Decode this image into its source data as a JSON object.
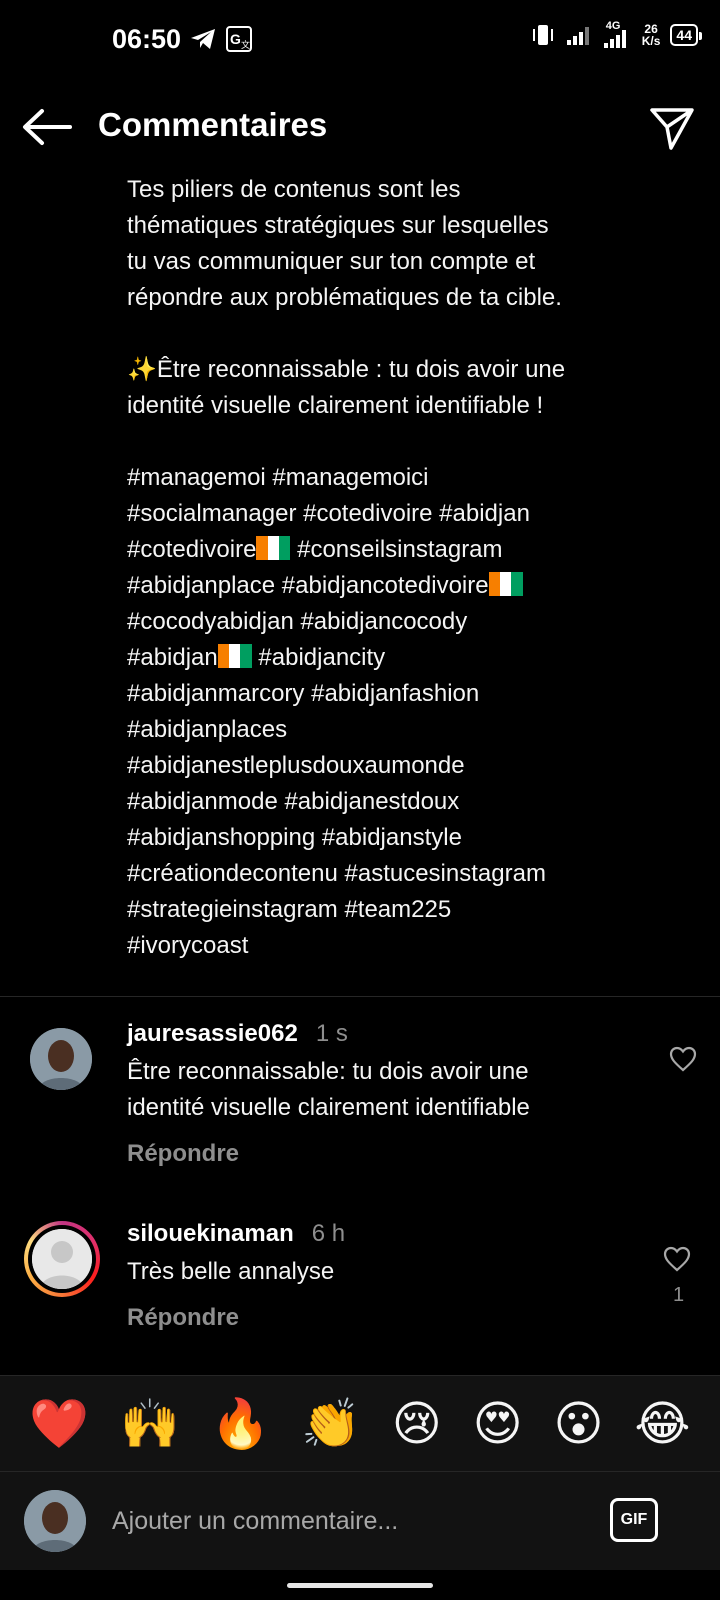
{
  "status": {
    "time": "06:50",
    "net_speed_value": "26",
    "net_speed_unit": "K/s",
    "network": "4G",
    "battery": "44"
  },
  "header": {
    "title": "Commentaires"
  },
  "caption": {
    "para1": [
      "Tes piliers de contenus sont les",
      "thématiques stratégiques sur lesquelles",
      "tu vas communiquer sur ton compte et",
      "répondre aux problématiques de ta cible."
    ],
    "para2": [
      "✨Être reconnaissable : tu dois avoir une",
      "identité visuelle clairement identifiable !"
    ],
    "hashtags": {
      "l1": "#managemoi #managemoici",
      "l2": "#socialmanager #cotedivoire #abidjan",
      "l3a": "#cotedivoire",
      "l3b": " #conseilsinstagram",
      "l4a": "#abidjanplace #abidjancotedivoire",
      "l5": "#cocodyabidjan #abidjancocody",
      "l6a": "#abidjan",
      "l6b": " #abidjancity",
      "l7": "#abidjanmarcory #abidjanfashion",
      "l8": "#abidjanplaces",
      "l9": "#abidjanestleplusdouxaumonde",
      "l10": "#abidjanmode #abidjanestdoux",
      "l11": "#abidjanshopping #abidjanstyle",
      "l12": "#créationdecontenu #astucesinstagram",
      "l13": "#strategieinstagram #team225",
      "l14": "#ivorycoast"
    }
  },
  "comments": [
    {
      "username": "jauresassie062",
      "time": "1 s",
      "text_l1": "Être reconnaissable: tu dois avoir une",
      "text_l2": "identité visuelle clairement identifiable",
      "reply": "Répondre"
    },
    {
      "username": "silouekinaman",
      "time": "6 h",
      "text_l1": "Très belle annalyse",
      "likes": "1",
      "reply": "Répondre"
    }
  ],
  "emojis": [
    "❤️",
    "🙌",
    "🔥",
    "👏",
    "😢",
    "😍",
    "😮",
    "😂"
  ],
  "input": {
    "placeholder": "Ajouter un commentaire...",
    "gif": "GIF"
  },
  "colors": {
    "flag_orange": "#f77f00",
    "flag_white": "#ffffff",
    "flag_green": "#009e60"
  }
}
